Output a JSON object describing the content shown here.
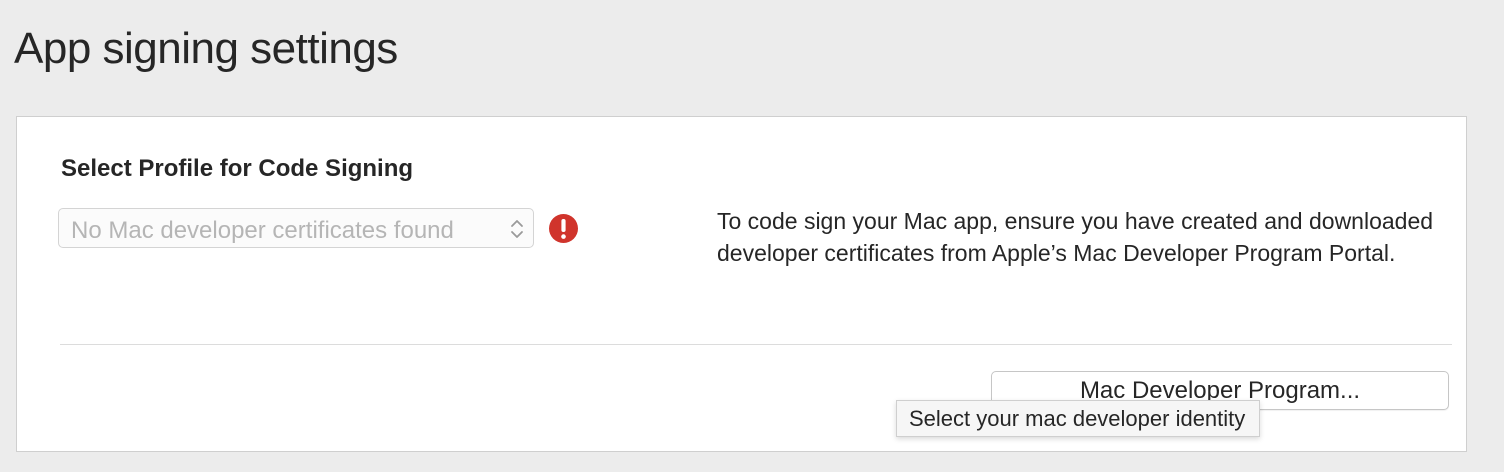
{
  "page": {
    "title": "App signing settings"
  },
  "signing": {
    "section_title": "Select Profile for Code Signing",
    "profile_select": {
      "value": "No Mac developer certificates found",
      "state": "disabled"
    },
    "status_icon": "error-exclamation-icon",
    "help_text": "To code sign your Mac app, ensure you have created and downloaded developer certificates from Apple’s Mac Developer Program Portal."
  },
  "actions": {
    "program_button_label": "Mac Developer Program..."
  },
  "tooltip": {
    "text": "Select your mac developer identity"
  },
  "colors": {
    "background": "#ececec",
    "panel": "#ffffff",
    "error": "#d0342c",
    "disabled_text": "#b5b5b5"
  }
}
